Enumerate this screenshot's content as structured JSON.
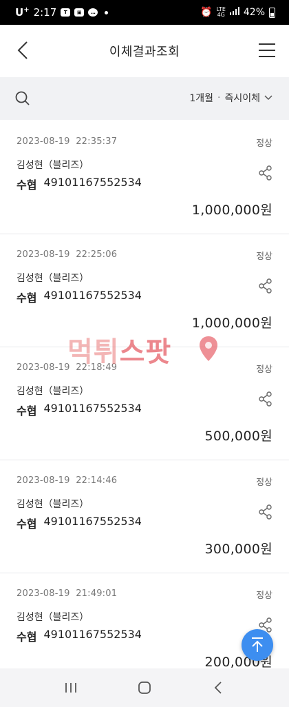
{
  "status_bar": {
    "carrier": "U",
    "carrier_sup": "+",
    "time": "2:17",
    "notif_icons": [
      "talk-icon",
      "image-icon",
      "chat-icon"
    ],
    "network": "LTE",
    "network_sub": "4G",
    "battery": "42%"
  },
  "header": {
    "title": "이체결과조회"
  },
  "filter": {
    "period": "1개월",
    "separator": "·",
    "type": "즉시이체"
  },
  "transactions": [
    {
      "datetime": "2023-08-19  22:35:37",
      "status": "정상",
      "name": "김성현（블리즈）",
      "bank": "수협",
      "account": "49101167552534",
      "amount": "1,000,000원"
    },
    {
      "datetime": "2023-08-19  22:25:06",
      "status": "정상",
      "name": "김성현（블리즈）",
      "bank": "수협",
      "account": "49101167552534",
      "amount": "1,000,000원"
    },
    {
      "datetime": "2023-08-19  22:18:49",
      "status": "정상",
      "name": "김성현（블리즈）",
      "bank": "수협",
      "account": "49101167552534",
      "amount": "500,000원"
    },
    {
      "datetime": "2023-08-19  22:14:46",
      "status": "정상",
      "name": "김성현（블리즈）",
      "bank": "수협",
      "account": "49101167552534",
      "amount": "300,000원"
    },
    {
      "datetime": "2023-08-19  21:49:01",
      "status": "정상",
      "name": "김성현（블리즈）",
      "bank": "수협",
      "account": "49101167552534",
      "amount": "200,000원"
    }
  ],
  "watermark": {
    "part1": "먹튀",
    "part2": "스팟"
  },
  "colors": {
    "fab": "#3d8ef0",
    "filter_bg": "#f1f2f4",
    "watermark": "#e24650"
  }
}
